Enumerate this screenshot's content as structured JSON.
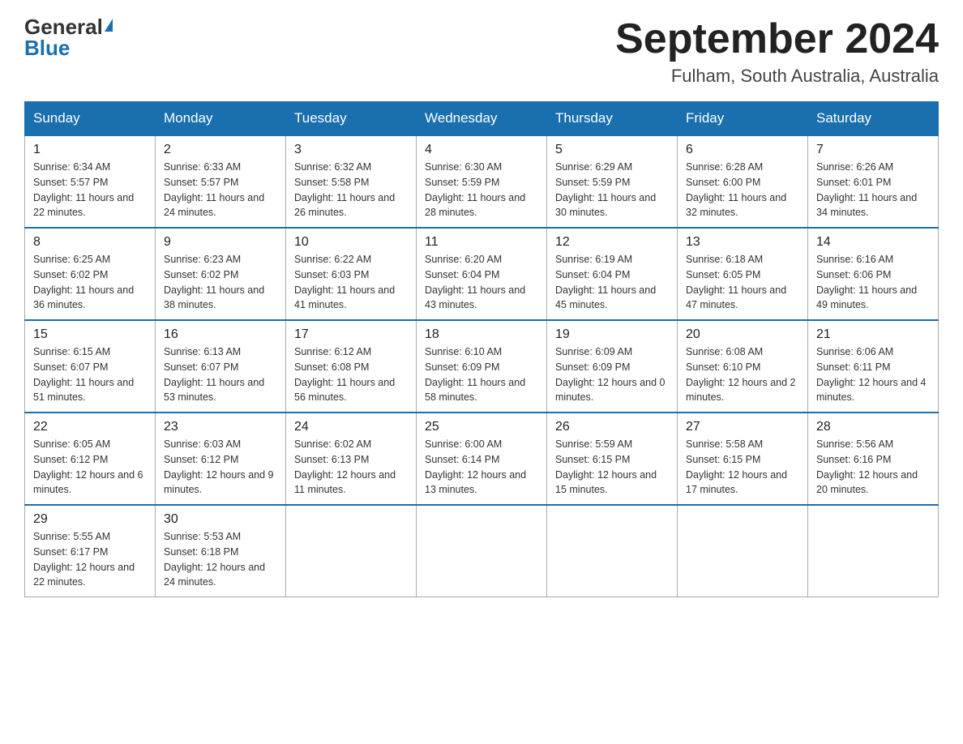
{
  "header": {
    "logo_general": "General",
    "logo_blue": "Blue",
    "month_title": "September 2024",
    "location": "Fulham, South Australia, Australia"
  },
  "days_of_week": [
    "Sunday",
    "Monday",
    "Tuesday",
    "Wednesday",
    "Thursday",
    "Friday",
    "Saturday"
  ],
  "weeks": [
    [
      {
        "day": "1",
        "sunrise": "6:34 AM",
        "sunset": "5:57 PM",
        "daylight": "11 hours and 22 minutes."
      },
      {
        "day": "2",
        "sunrise": "6:33 AM",
        "sunset": "5:57 PM",
        "daylight": "11 hours and 24 minutes."
      },
      {
        "day": "3",
        "sunrise": "6:32 AM",
        "sunset": "5:58 PM",
        "daylight": "11 hours and 26 minutes."
      },
      {
        "day": "4",
        "sunrise": "6:30 AM",
        "sunset": "5:59 PM",
        "daylight": "11 hours and 28 minutes."
      },
      {
        "day": "5",
        "sunrise": "6:29 AM",
        "sunset": "5:59 PM",
        "daylight": "11 hours and 30 minutes."
      },
      {
        "day": "6",
        "sunrise": "6:28 AM",
        "sunset": "6:00 PM",
        "daylight": "11 hours and 32 minutes."
      },
      {
        "day": "7",
        "sunrise": "6:26 AM",
        "sunset": "6:01 PM",
        "daylight": "11 hours and 34 minutes."
      }
    ],
    [
      {
        "day": "8",
        "sunrise": "6:25 AM",
        "sunset": "6:02 PM",
        "daylight": "11 hours and 36 minutes."
      },
      {
        "day": "9",
        "sunrise": "6:23 AM",
        "sunset": "6:02 PM",
        "daylight": "11 hours and 38 minutes."
      },
      {
        "day": "10",
        "sunrise": "6:22 AM",
        "sunset": "6:03 PM",
        "daylight": "11 hours and 41 minutes."
      },
      {
        "day": "11",
        "sunrise": "6:20 AM",
        "sunset": "6:04 PM",
        "daylight": "11 hours and 43 minutes."
      },
      {
        "day": "12",
        "sunrise": "6:19 AM",
        "sunset": "6:04 PM",
        "daylight": "11 hours and 45 minutes."
      },
      {
        "day": "13",
        "sunrise": "6:18 AM",
        "sunset": "6:05 PM",
        "daylight": "11 hours and 47 minutes."
      },
      {
        "day": "14",
        "sunrise": "6:16 AM",
        "sunset": "6:06 PM",
        "daylight": "11 hours and 49 minutes."
      }
    ],
    [
      {
        "day": "15",
        "sunrise": "6:15 AM",
        "sunset": "6:07 PM",
        "daylight": "11 hours and 51 minutes."
      },
      {
        "day": "16",
        "sunrise": "6:13 AM",
        "sunset": "6:07 PM",
        "daylight": "11 hours and 53 minutes."
      },
      {
        "day": "17",
        "sunrise": "6:12 AM",
        "sunset": "6:08 PM",
        "daylight": "11 hours and 56 minutes."
      },
      {
        "day": "18",
        "sunrise": "6:10 AM",
        "sunset": "6:09 PM",
        "daylight": "11 hours and 58 minutes."
      },
      {
        "day": "19",
        "sunrise": "6:09 AM",
        "sunset": "6:09 PM",
        "daylight": "12 hours and 0 minutes."
      },
      {
        "day": "20",
        "sunrise": "6:08 AM",
        "sunset": "6:10 PM",
        "daylight": "12 hours and 2 minutes."
      },
      {
        "day": "21",
        "sunrise": "6:06 AM",
        "sunset": "6:11 PM",
        "daylight": "12 hours and 4 minutes."
      }
    ],
    [
      {
        "day": "22",
        "sunrise": "6:05 AM",
        "sunset": "6:12 PM",
        "daylight": "12 hours and 6 minutes."
      },
      {
        "day": "23",
        "sunrise": "6:03 AM",
        "sunset": "6:12 PM",
        "daylight": "12 hours and 9 minutes."
      },
      {
        "day": "24",
        "sunrise": "6:02 AM",
        "sunset": "6:13 PM",
        "daylight": "12 hours and 11 minutes."
      },
      {
        "day": "25",
        "sunrise": "6:00 AM",
        "sunset": "6:14 PM",
        "daylight": "12 hours and 13 minutes."
      },
      {
        "day": "26",
        "sunrise": "5:59 AM",
        "sunset": "6:15 PM",
        "daylight": "12 hours and 15 minutes."
      },
      {
        "day": "27",
        "sunrise": "5:58 AM",
        "sunset": "6:15 PM",
        "daylight": "12 hours and 17 minutes."
      },
      {
        "day": "28",
        "sunrise": "5:56 AM",
        "sunset": "6:16 PM",
        "daylight": "12 hours and 20 minutes."
      }
    ],
    [
      {
        "day": "29",
        "sunrise": "5:55 AM",
        "sunset": "6:17 PM",
        "daylight": "12 hours and 22 minutes."
      },
      {
        "day": "30",
        "sunrise": "5:53 AM",
        "sunset": "6:18 PM",
        "daylight": "12 hours and 24 minutes."
      },
      null,
      null,
      null,
      null,
      null
    ]
  ],
  "labels": {
    "sunrise_prefix": "Sunrise: ",
    "sunset_prefix": "Sunset: ",
    "daylight_prefix": "Daylight: "
  }
}
